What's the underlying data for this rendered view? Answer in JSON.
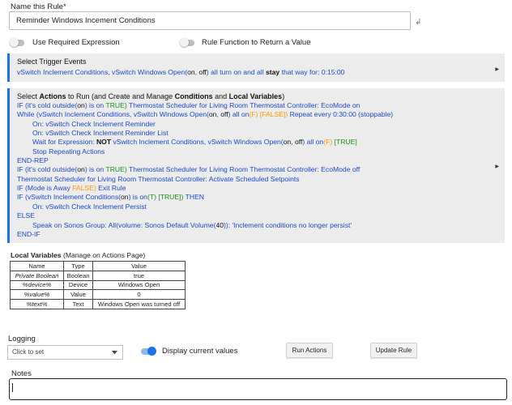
{
  "rule": {
    "name_label": "Name this Rule*",
    "name_value": "Reminder Windows Incement Conditions",
    "enter_glyph": "↲",
    "use_required_label": "Use Required Expression",
    "rule_function_label": "Rule Function to Return a Value"
  },
  "trigger": {
    "heading": "Select Trigger Events",
    "text_a": "vSwitch Inclement Conditions, vSwitch Windows Open(",
    "on": "on",
    "sep": ", ",
    "off": "off",
    "text_b": ") all turn on and all ",
    "stay": "stay",
    "text_c": " that way for: 0:15:00"
  },
  "actions": {
    "heading_a": "Select ",
    "heading_actions": "Actions",
    "heading_b": " to Run (and Create and Manage ",
    "heading_conditions": "Conditions",
    "heading_c": " and ",
    "heading_locals": "Local Variables",
    "heading_d": ")",
    "l1_a": "IF (it's cold outside(",
    "l1_on": "on",
    "l1_b": ") is on ",
    "l1_true": "TRUE)",
    "l1_c": " Thermostat Scheduler for Living Room Thermostat Controller: EcoMode on",
    "l2_a": "While (vSwitch Inclement Conditions, vSwitch Windows Open(",
    "l2_on": "on",
    "l2_sep": ", ",
    "l2_off": "off",
    "l2_b": ") all on",
    "l2_f": "(F) [FALSE])",
    "l2_c": " Repeat every 0:30:00 (stoppable)",
    "l3": "On: vSwitch Check Inclement Reminder",
    "l4": "On: vSwitch Check Inclement Reminder List",
    "l5_a": "Wait for Expression: ",
    "l5_not": "NOT",
    "l5_b": " vSwitch Inclement Conditions, vSwitch Windows Open(",
    "l5_on": "on",
    "l5_sep": ", ",
    "l5_off": "off",
    "l5_c": ") all on",
    "l5_f": "(F)",
    "l5_true": " [TRUE]",
    "l6": "Stop Repeating Actions",
    "l7": "END-REP",
    "l8_a": "IF (it's cold outside(",
    "l8_on": "on",
    "l8_b": ") is on ",
    "l8_true": "TRUE)",
    "l8_c": " Thermostat Scheduler for Living Room Thermostat Controller: EcoMode off",
    "l9": "Thermostat Scheduler for Living Room Thermostat Controller: Activate Scheduled Setpoints",
    "l10_a": "IF (Mode is Away ",
    "l10_false": "FALSE)",
    "l10_b": " Exit Rule",
    "l11_a": "IF (vSwitch Inclement Conditions(",
    "l11_on": "on",
    "l11_b": ") is on",
    "l11_t": "(T) [TRUE])",
    "l11_c": " THEN",
    "l12": "On: vSwitch Check Inclement Persist",
    "l13": "ELSE",
    "l14_a": "Speak on Sonos Group: All(volume: Sonos Default Volume(",
    "l14_num": "40",
    "l14_b": ")): 'Inclement conditions no longer persist'",
    "l15": "END-IF"
  },
  "locals": {
    "label": "Local Variables",
    "label_note": " (Manage on Actions Page)",
    "headers": [
      "Name",
      "Type",
      "Value"
    ],
    "rows": [
      [
        "Private Boolean",
        "Boolean",
        "true"
      ],
      [
        "%device%",
        "Device",
        "Windows Open"
      ],
      [
        "%value%",
        "Value",
        "0"
      ],
      [
        "%text%",
        "Text",
        "Windows Open was turned off"
      ]
    ]
  },
  "logging": {
    "label": "Logging",
    "placeholder": "Click to set",
    "display_label": "Display current values",
    "display_on": true
  },
  "buttons": {
    "run": "Run Actions",
    "update": "Update Rule"
  },
  "notes": {
    "label": "Notes",
    "value": ""
  },
  "colors": {
    "accent": "#1a73e8",
    "text_blue": "#1c49c4",
    "green": "#1a8f1a",
    "orange": "#ff9800"
  }
}
